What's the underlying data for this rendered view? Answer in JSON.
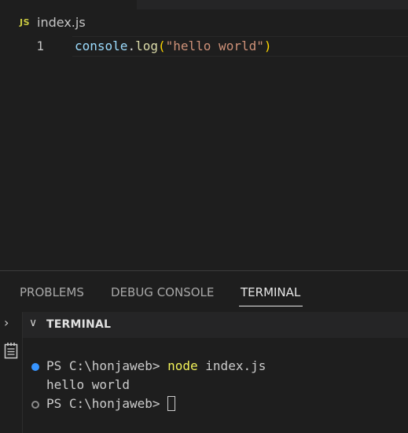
{
  "editor": {
    "tab": {
      "icon": "JS",
      "label": "index.js"
    },
    "line_number": "1",
    "code": {
      "object": "console",
      "dot": ".",
      "method": "log",
      "open_paren": "(",
      "string": "\"hello world\"",
      "close_paren": ")"
    }
  },
  "panel": {
    "tabs": [
      {
        "label": "PROBLEMS"
      },
      {
        "label": "DEBUG CONSOLE"
      },
      {
        "label": "TERMINAL"
      }
    ],
    "active_tab": "TERMINAL",
    "section_title": "TERMINAL"
  },
  "terminal": {
    "lines": [
      {
        "prompt": "PS C:\\honjaweb> ",
        "command": "node",
        "args": " index.js",
        "marker": "success"
      },
      {
        "output": "hello world"
      },
      {
        "prompt": "PS C:\\honjaweb> ",
        "marker": "pending"
      }
    ]
  },
  "colors": {
    "background": "#1e1e1e",
    "js_icon": "#cbcb41",
    "success_marker": "#3794ff",
    "command": "#f1f159"
  },
  "icons": [
    "js-file-icon",
    "chevron-right-icon",
    "notes-icon",
    "chevron-down-icon"
  ]
}
